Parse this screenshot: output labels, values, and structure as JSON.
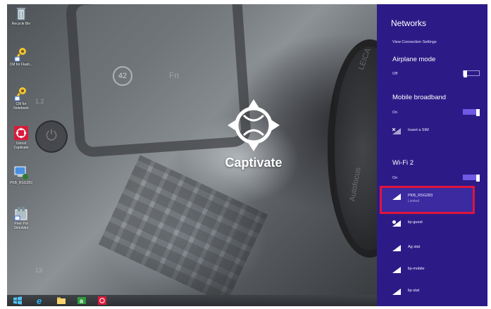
{
  "desktop": {
    "icons": [
      {
        "name": "recycle-bin",
        "label": "Recycle Bin"
      },
      {
        "name": "cm-key-1",
        "label": "CM for Flash..."
      },
      {
        "name": "cm-key-2",
        "label": "CM for Notebook"
      },
      {
        "name": "uninstall-captivate",
        "label": "Uninst Captivate"
      },
      {
        "name": "pkb-network",
        "label": "PKB_RSG283"
      },
      {
        "name": "app-simulator",
        "label": "Peer Pol Simulator"
      }
    ],
    "wallpaper": {
      "badge_number": "42",
      "fn_text": "Fn",
      "side_number": "1.2",
      "side_number_bottom": "13",
      "brand_top": "LEICA",
      "brand_side": "Autofocus"
    },
    "logo_text": "Captivate"
  },
  "taskbar": {
    "items": [
      "start",
      "internet-explorer",
      "file-explorer",
      "store",
      "captivate"
    ]
  },
  "networks": {
    "title": "Networks",
    "view_settings": "View Connection Settings",
    "airplane": {
      "title": "Airplane mode",
      "state": "Off"
    },
    "mobile": {
      "title": "Mobile broadband",
      "state": "On",
      "insert_sim": "Insert a SIM"
    },
    "wifi": {
      "title": "Wi-Fi 2",
      "state": "On"
    },
    "list": [
      {
        "ssid": "PKB_RSG283",
        "status": "Limited"
      },
      {
        "ssid": "lip-guest",
        "status": ""
      },
      {
        "ssid": "Ag stat",
        "status": ""
      },
      {
        "ssid": "lip-mobile",
        "status": ""
      },
      {
        "ssid": "lip-stat",
        "status": ""
      }
    ],
    "colors": {
      "panel": "#2c1b87",
      "toggle_on": "#6f5ae6",
      "highlight": "#e0143c"
    }
  }
}
